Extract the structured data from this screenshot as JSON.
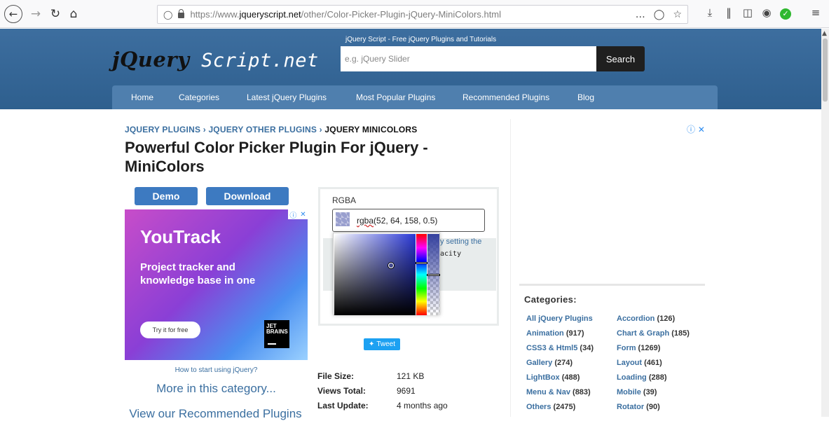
{
  "browser": {
    "url_prefix": "https://www.",
    "url_domain": "jqueryscript.net",
    "url_path": "/other/Color-Picker-Plugin-jQuery-MiniColors.html",
    "page_actions": "…",
    "icons": [
      "back-icon",
      "forward-icon",
      "reload-icon",
      "home-icon",
      "shield-icon",
      "lock-icon",
      "pocket-icon",
      "bookmark-star-icon",
      "download-icon",
      "library-icon",
      "sidebar-icon",
      "account-icon",
      "extension-check-icon",
      "menu-icon"
    ]
  },
  "header": {
    "logo_part1": "jQuery",
    "logo_part2": " Script.net",
    "tagline": "jQuery Script - Free jQuery Plugins and Tutorials",
    "search_placeholder": "e.g. jQuery Slider",
    "search_button": "Search"
  },
  "menu": [
    "Home",
    "Categories",
    "Latest jQuery Plugins",
    "Most Popular Plugins",
    "Recommended Plugins",
    "Blog"
  ],
  "breadcrumb": {
    "item1": "JQUERY PLUGINS",
    "sep": " › ",
    "item2": "JQUERY OTHER PLUGINS",
    "current": "JQUERY MINICOLORS"
  },
  "title": "Powerful Color Picker Plugin For jQuery - MiniColors",
  "buttons": {
    "demo": "Demo",
    "download": "Download"
  },
  "ad": {
    "brand": "YouTrack",
    "tagline": "Project tracker and knowledge base in one",
    "cta": "Try it for free",
    "logo_line1": "JET",
    "logo_line2": "BRAINS",
    "choice_icon": "ⓘ",
    "close": "✕"
  },
  "links": {
    "how_to": "How to start using jQuery?",
    "more_category": "More in this category...",
    "recommended": "View our Recommended Plugins"
  },
  "picker": {
    "label": "RGBA",
    "value_fn": "rgba",
    "value_args": "(52, 64, 158, 0.5)",
    "hint_text": "y setting the",
    "hint_code": "acity",
    "swatch_color": "#34409e"
  },
  "tweet": "Tweet",
  "info": [
    {
      "key": "File Size:",
      "value": "121 KB"
    },
    {
      "key": "Views Total:",
      "value": "9691"
    },
    {
      "key": "Last Update:",
      "value": "4 months ago"
    }
  ],
  "sidebar": {
    "ad_marker": "ⓘ ✕",
    "categories_title": "Categories:",
    "col1": [
      {
        "label": "All jQuery Plugins",
        "count": ""
      },
      {
        "label": "Animation",
        "count": " (917)"
      },
      {
        "label": "CSS3 & Html5",
        "count": " (34)"
      },
      {
        "label": "Gallery",
        "count": " (274)"
      },
      {
        "label": "LightBox",
        "count": " (488)"
      },
      {
        "label": "Menu & Nav",
        "count": " (883)"
      },
      {
        "label": "Others",
        "count": " (2475)"
      }
    ],
    "col2": [
      {
        "label": "Accordion",
        "count": " (126)"
      },
      {
        "label": "Chart & Graph",
        "count": " (185)"
      },
      {
        "label": "Form",
        "count": " (1269)"
      },
      {
        "label": "Layout",
        "count": " (461)"
      },
      {
        "label": "Loading",
        "count": " (288)"
      },
      {
        "label": "Mobile",
        "count": " (39)"
      },
      {
        "label": "Rotator",
        "count": " (90)"
      }
    ]
  },
  "colors": {
    "accent": "#3d7ac1",
    "header": "#3d6e9f",
    "link": "#3b6fa0"
  }
}
